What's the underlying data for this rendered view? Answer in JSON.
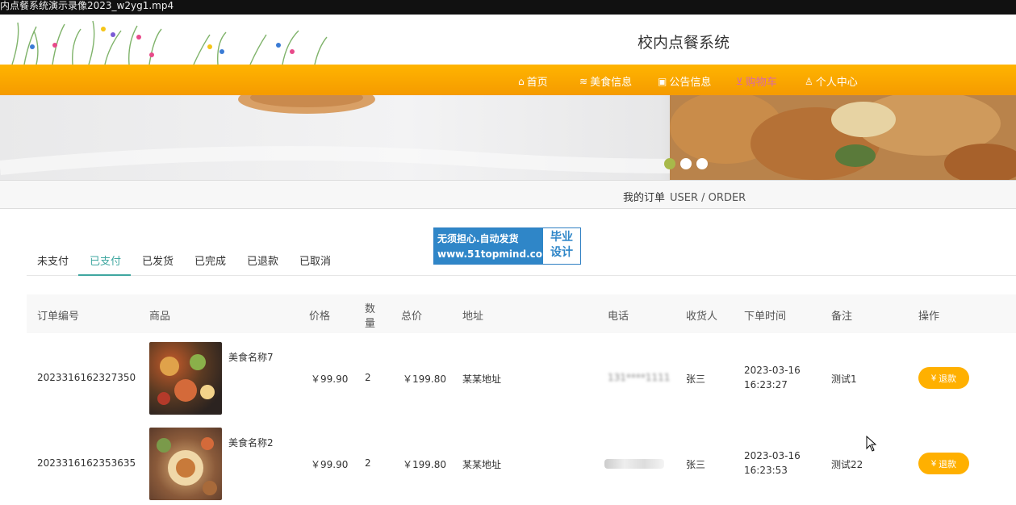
{
  "window": {
    "title": "内点餐系统演示录像2023_w2yg1.mp4"
  },
  "header": {
    "site_title": "校内点餐系统"
  },
  "nav": [
    {
      "icon": "home-icon",
      "label": "首页"
    },
    {
      "icon": "layers-icon",
      "label": "美食信息"
    },
    {
      "icon": "notice-icon",
      "label": "公告信息"
    },
    {
      "icon": "cart-icon",
      "label": "购物车",
      "active": true
    },
    {
      "icon": "user-icon",
      "label": "个人中心"
    }
  ],
  "banner": {
    "active_slide": 1,
    "slides": 3
  },
  "breadcrumb": {
    "cn": "我的订单",
    "en": "USER / ORDER"
  },
  "watermark": {
    "line1": "无须担心.自动发货",
    "line2": "www.51topmind.com",
    "side1": "毕业",
    "side2": "设计"
  },
  "tabs": [
    "未支付",
    "已支付",
    "已发货",
    "已完成",
    "已退款",
    "已取消"
  ],
  "active_tab": "已支付",
  "columns": {
    "order_no": "订单编号",
    "product": "商品",
    "price": "价格",
    "qty_a": "数",
    "qty_b": "量",
    "total": "总价",
    "address": "地址",
    "phone": "电话",
    "receiver": "收货人",
    "time": "下单时间",
    "remark": "备注",
    "action": "操作"
  },
  "orders": [
    {
      "order_no": "2023316162327350",
      "product": "美食名称7",
      "price": "￥99.90",
      "qty": "2",
      "total": "￥199.80",
      "address": "某某地址",
      "phone": "131****1111",
      "receiver": "张三",
      "date": "2023-03-16",
      "time": "16:23:27",
      "remark": "测试1",
      "action": "退款"
    },
    {
      "order_no": "2023316162353635",
      "product": "美食名称2",
      "price": "￥99.90",
      "qty": "2",
      "total": "￥199.80",
      "address": "某某地址",
      "phone": "",
      "receiver": "张三",
      "date": "2023-03-16",
      "time": "16:23:53",
      "remark": "测试22",
      "action": "退款"
    }
  ],
  "colors": {
    "nav_orange": "#f5a500",
    "accent_teal": "#3fa7a0",
    "refund_orange": "#ffb000",
    "active_nav": "#d96aa4"
  }
}
